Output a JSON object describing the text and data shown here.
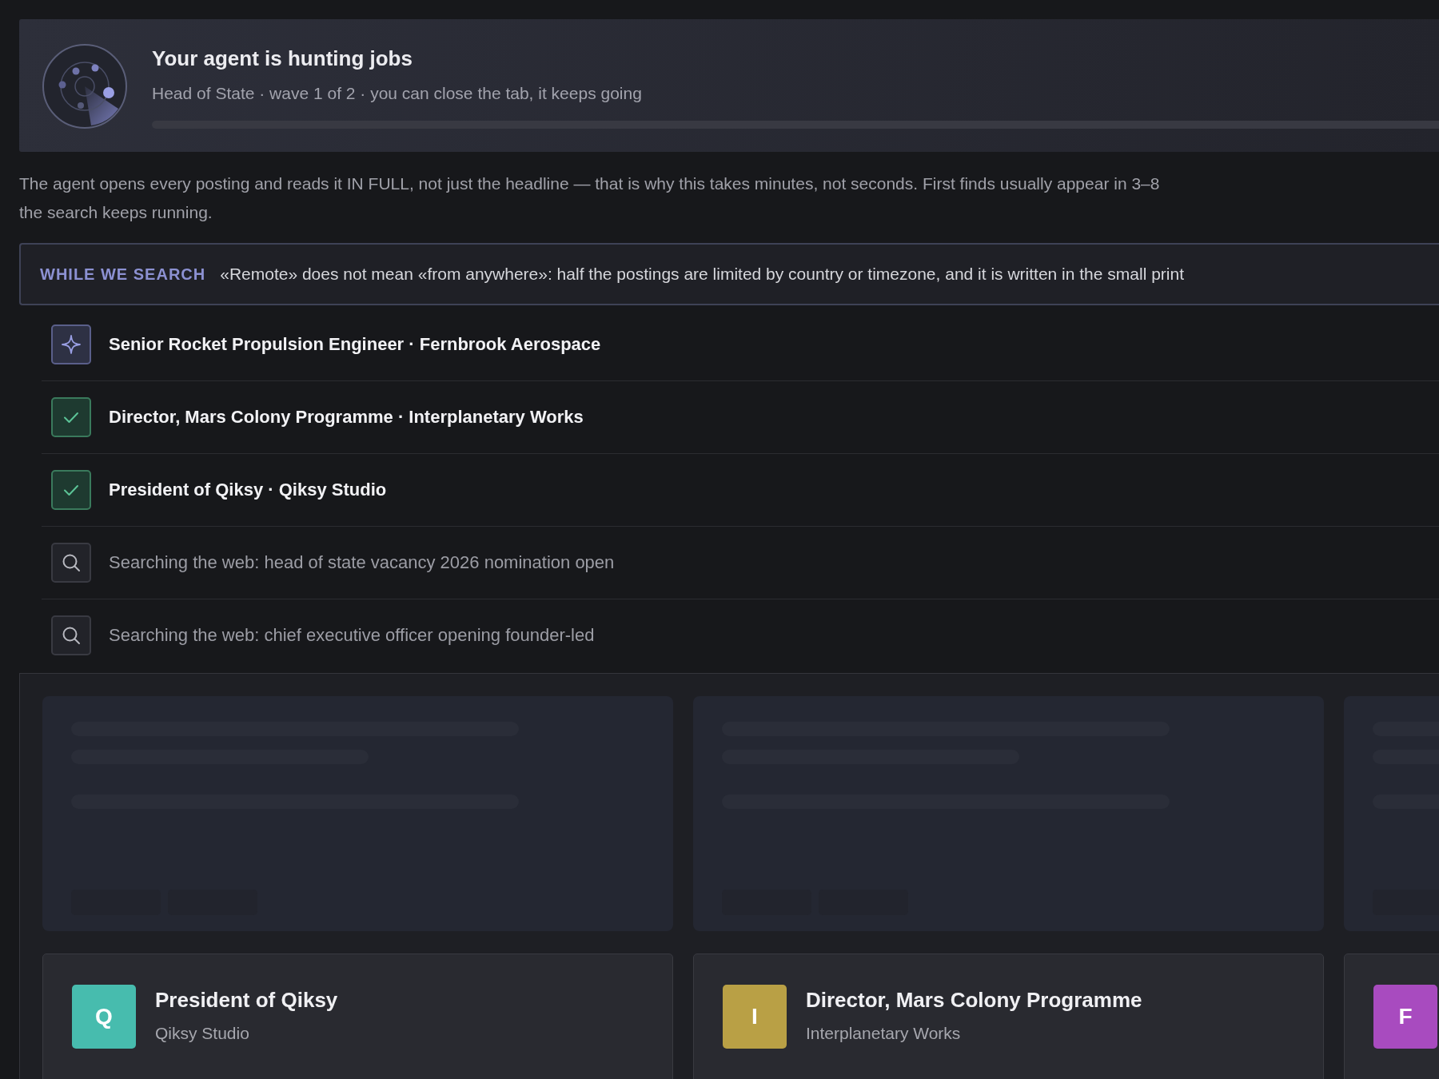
{
  "header": {
    "title": "Your agent is hunting jobs",
    "subtitle": "Head of State · wave 1 of 2 · you can close the tab, it keeps going",
    "progress": {
      "level": 0
    }
  },
  "intro": [
    "The agent opens every posting and reads it IN FULL, not just the headline — that is why this takes minutes, not seconds. First finds usually appear in 3–8",
    "the search keeps running."
  ],
  "tip": {
    "label": "WHILE WE SEARCH",
    "text": "«Remote» does not mean «from anywhere»: half the postings are limited by country or timezone, and it is written in the small print"
  },
  "activity": [
    {
      "kind": "analyzing",
      "text": "Senior Rocket Propulsion Engineer · Fernbrook Aerospace"
    },
    {
      "kind": "found",
      "text": "Director, Mars Colony Programme · Interplanetary Works"
    },
    {
      "kind": "found",
      "text": "President of Qiksy · Qiksy Studio"
    },
    {
      "kind": "search",
      "text": "Searching the web: head of state vacancy 2026 nomination open"
    },
    {
      "kind": "search",
      "text": "Searching the web: chief executive officer opening founder-led"
    }
  ],
  "cards": [
    {
      "kind": "placeholder"
    },
    {
      "kind": "placeholder"
    },
    {
      "kind": "placeholder"
    },
    {
      "kind": "job",
      "letter": "Q",
      "color": "#47bcae",
      "title": "President of Qiksy",
      "company": "Qiksy Studio"
    },
    {
      "kind": "job",
      "letter": "I",
      "color": "#b9a045",
      "title": "Director, Mars Colony Programme",
      "company": "Interplanetary Works"
    },
    {
      "kind": "job",
      "letter": "F",
      "color": "#a84bbf"
    }
  ]
}
